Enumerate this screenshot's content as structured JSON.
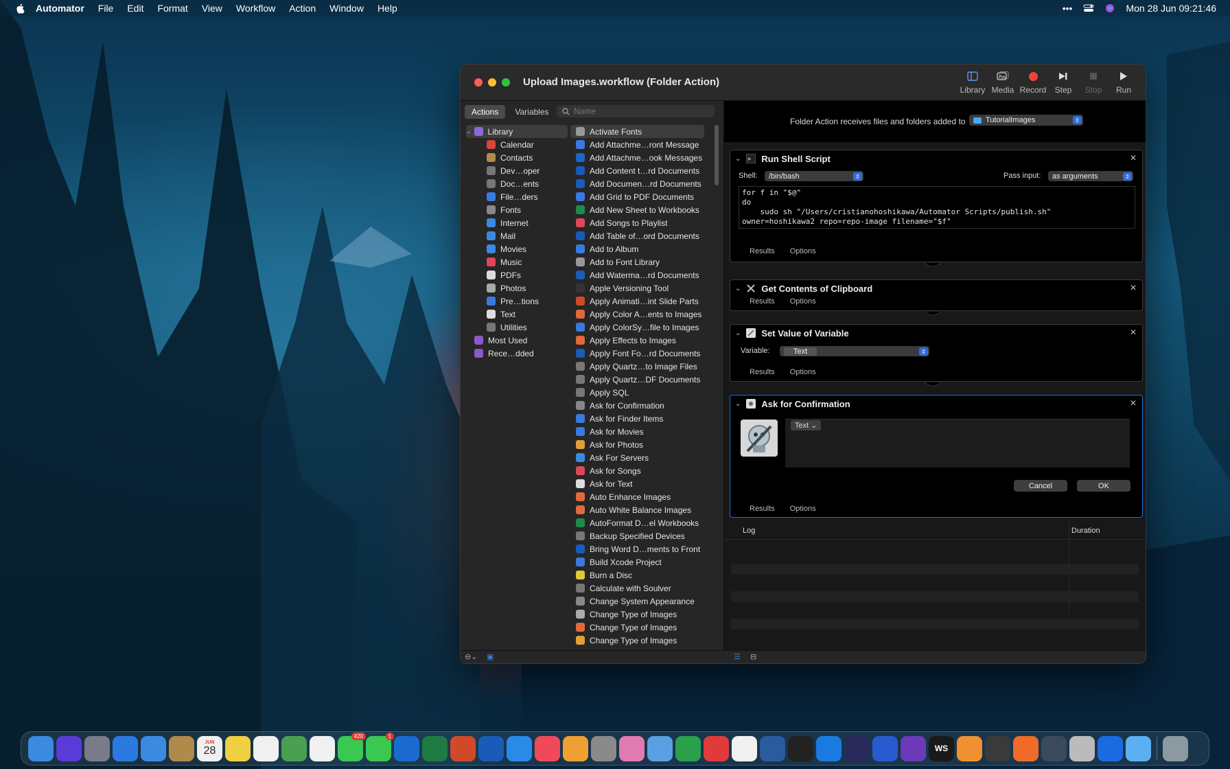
{
  "menubar": {
    "app": "Automator",
    "items": [
      "File",
      "Edit",
      "Format",
      "View",
      "Workflow",
      "Action",
      "Window",
      "Help"
    ],
    "clock": "Mon 28 Jun  09:21:46"
  },
  "window": {
    "title": "Upload Images.workflow (Folder Action)",
    "toolbar": {
      "library": "Library",
      "media": "Media",
      "record": "Record",
      "step": "Step",
      "stop": "Stop",
      "run": "Run"
    },
    "tabs": {
      "actions": "Actions",
      "variables": "Variables"
    },
    "search_placeholder": "Name",
    "categories": [
      {
        "label": "Library",
        "color": "#8a6ad8"
      },
      {
        "label": "Calendar",
        "color": "#d8453a"
      },
      {
        "label": "Contacts",
        "color": "#b08a4a"
      },
      {
        "label": "Dev…oper",
        "color": "#777777"
      },
      {
        "label": "Doc…ents",
        "color": "#777777"
      },
      {
        "label": "File…ders",
        "color": "#3a7ae0"
      },
      {
        "label": "Fonts",
        "color": "#888888"
      },
      {
        "label": "Internet",
        "color": "#3a8ae0"
      },
      {
        "label": "Mail",
        "color": "#3a8ae0"
      },
      {
        "label": "Movies",
        "color": "#3a8ae0"
      },
      {
        "label": "Music",
        "color": "#e0465a"
      },
      {
        "label": "PDFs",
        "color": "#dddddd"
      },
      {
        "label": "Photos",
        "color": "#aaaaaa"
      },
      {
        "label": "Pre…tions",
        "color": "#3a7ae0"
      },
      {
        "label": "Text",
        "color": "#dddddd"
      },
      {
        "label": "Utilities",
        "color": "#777777"
      },
      {
        "label": "Most Used",
        "color": "#8a5ac8"
      },
      {
        "label": "Rece…dded",
        "color": "#8a5ac8"
      }
    ],
    "actions": [
      {
        "label": "Activate Fonts",
        "color": "#999999"
      },
      {
        "label": "Add Attachme…ront Message",
        "color": "#3a7ae0"
      },
      {
        "label": "Add Attachme…ook Messages",
        "color": "#1a66c8"
      },
      {
        "label": "Add Content t…rd Documents",
        "color": "#1a5ab8"
      },
      {
        "label": "Add Documen…rd Documents",
        "color": "#1a5ab8"
      },
      {
        "label": "Add Grid to PDF Documents",
        "color": "#3a7ae0"
      },
      {
        "label": "Add New Sheet to Workbooks",
        "color": "#1f8a4a"
      },
      {
        "label": "Add Songs to Playlist",
        "color": "#e0465a"
      },
      {
        "label": "Add Table of…ord Documents",
        "color": "#1a5ab8"
      },
      {
        "label": "Add to Album",
        "color": "#3a7ae0"
      },
      {
        "label": "Add to Font Library",
        "color": "#999999"
      },
      {
        "label": "Add Waterma…rd Documents",
        "color": "#1a5ab8"
      },
      {
        "label": "Apple Versioning Tool",
        "color": "#333333"
      },
      {
        "label": "Apply Animati…int Slide Parts",
        "color": "#d04a2a"
      },
      {
        "label": "Apply Color A…ents to Images",
        "color": "#e06a3a"
      },
      {
        "label": "Apply ColorSy…file to Images",
        "color": "#3a7ae0"
      },
      {
        "label": "Apply Effects to Images",
        "color": "#e06a3a"
      },
      {
        "label": "Apply Font Fo…rd Documents",
        "color": "#1a5ab8"
      },
      {
        "label": "Apply Quartz…to Image Files",
        "color": "#777777"
      },
      {
        "label": "Apply Quartz…DF Documents",
        "color": "#777777"
      },
      {
        "label": "Apply SQL",
        "color": "#777777"
      },
      {
        "label": "Ask for Confirmation",
        "color": "#888888"
      },
      {
        "label": "Ask for Finder Items",
        "color": "#3a7ae0"
      },
      {
        "label": "Ask for Movies",
        "color": "#3a7ae0"
      },
      {
        "label": "Ask for Photos",
        "color": "#e0a03a"
      },
      {
        "label": "Ask For Servers",
        "color": "#3a8ae0"
      },
      {
        "label": "Ask for Songs",
        "color": "#e0465a"
      },
      {
        "label": "Ask for Text",
        "color": "#dddddd"
      },
      {
        "label": "Auto Enhance Images",
        "color": "#e06a3a"
      },
      {
        "label": "Auto White Balance Images",
        "color": "#e06a3a"
      },
      {
        "label": "AutoFormat D…el Workbooks",
        "color": "#1f8a4a"
      },
      {
        "label": "Backup Specified Devices",
        "color": "#777777"
      },
      {
        "label": "Bring Word D…ments to Front",
        "color": "#1a5ab8"
      },
      {
        "label": "Build Xcode Project",
        "color": "#3a7ae0"
      },
      {
        "label": "Burn a Disc",
        "color": "#e0c83a"
      },
      {
        "label": "Calculate with Soulver",
        "color": "#777777"
      },
      {
        "label": "Change System Appearance",
        "color": "#888888"
      },
      {
        "label": "Change Type of Images",
        "color": "#aaaaaa"
      },
      {
        "label": "Change Type of Images",
        "color": "#e06a3a"
      },
      {
        "label": "Change Type of Images",
        "color": "#e0a03a"
      }
    ],
    "folder_action": {
      "label": "Folder Action receives files and folders added to",
      "folder": "TutorialImages"
    },
    "cards": {
      "shell": {
        "title": "Run Shell Script",
        "shell_label": "Shell:",
        "shell_value": "/bin/bash",
        "pass_label": "Pass input:",
        "pass_value": "as arguments",
        "script": "for f in \"$@\"\ndo\n    sudo sh \"/Users/cristianohoshikawa/Automator Scripts/publish.sh\"\nowner=hoshikawa2 repo=repo-image filename=\"$f\"\ndone"
      },
      "clipboard": {
        "title": "Get Contents of Clipboard"
      },
      "variable": {
        "title": "Set Value of Variable",
        "label": "Variable:",
        "value": "Text"
      },
      "confirm": {
        "title": "Ask for Confirmation",
        "token": "Text ⌄",
        "cancel": "Cancel",
        "ok": "OK"
      },
      "results": "Results",
      "options": "Options"
    },
    "log": {
      "log": "Log",
      "duration": "Duration"
    }
  },
  "dock": {
    "apps": [
      {
        "name": "finder",
        "color": "#3a8ae0"
      },
      {
        "name": "siri",
        "color": "#5a3ad8"
      },
      {
        "name": "launchpad",
        "color": "#7a7a8a"
      },
      {
        "name": "safari",
        "color": "#2a7ae0"
      },
      {
        "name": "mail",
        "color": "#3a8ae0"
      },
      {
        "name": "contacts",
        "color": "#b08a4a"
      },
      {
        "name": "calendar",
        "color": "#f0f0f0"
      },
      {
        "name": "notes",
        "color": "#f0d040"
      },
      {
        "name": "reminders",
        "color": "#f0f0f0"
      },
      {
        "name": "maps",
        "color": "#4aa050"
      },
      {
        "name": "photos",
        "color": "#f0f0f0"
      },
      {
        "name": "messages",
        "color": "#3ac850"
      },
      {
        "name": "facetime",
        "color": "#3ac850"
      },
      {
        "name": "outlook",
        "color": "#1a6ad0"
      },
      {
        "name": "excel",
        "color": "#1f7a44"
      },
      {
        "name": "powerpoint",
        "color": "#d04a2a"
      },
      {
        "name": "word",
        "color": "#1a5ab8"
      },
      {
        "name": "app-store",
        "color": "#2a8ae8"
      },
      {
        "name": "music",
        "color": "#f04a5a"
      },
      {
        "name": "home",
        "color": "#f0a030"
      },
      {
        "name": "system-preferences",
        "color": "#8a8a8a"
      },
      {
        "name": "keynote-like",
        "color": "#e07ab0"
      },
      {
        "name": "preview",
        "color": "#5aa0e0"
      },
      {
        "name": "evernote",
        "color": "#2aa04a"
      },
      {
        "name": "pdf-app",
        "color": "#e03a3a"
      },
      {
        "name": "chrome",
        "color": "#f0f0f0"
      },
      {
        "name": "virtualbox",
        "color": "#2a5aa0"
      },
      {
        "name": "terminal",
        "color": "#222222"
      },
      {
        "name": "xcode-like",
        "color": "#1a7ae0"
      },
      {
        "name": "eclipse",
        "color": "#2a2a5a"
      },
      {
        "name": "firefox-dev",
        "color": "#2a5ad0"
      },
      {
        "name": "visual-studio",
        "color": "#6a3ab8"
      },
      {
        "name": "webstorm",
        "color": "#1a1a1a"
      },
      {
        "name": "slack-like",
        "color": "#f09030"
      },
      {
        "name": "sublime",
        "color": "#3a3a3a"
      },
      {
        "name": "pencil-app",
        "color": "#f06a2a"
      },
      {
        "name": "instruments",
        "color": "#3a4a5a"
      },
      {
        "name": "automator",
        "color": "#bbbbbb"
      },
      {
        "name": "dropbox",
        "color": "#1a6ae0"
      },
      {
        "name": "preview-2",
        "color": "#5ab0f0"
      },
      {
        "name": "trash",
        "color": "#8a9aa0"
      }
    ],
    "badges": {
      "messages": "420",
      "facetime": "1"
    },
    "calendar_day": "28",
    "calendar_month": "JUN",
    "webstorm_label": "WS"
  }
}
